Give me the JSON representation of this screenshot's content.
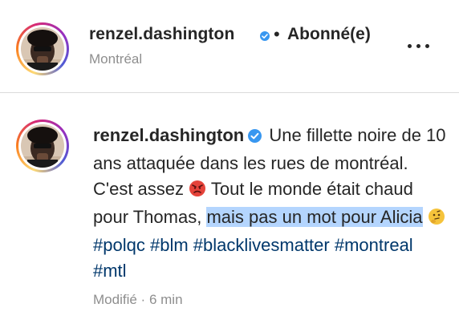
{
  "header": {
    "username": "renzel.dashington",
    "separator": "•",
    "follow_status": "Abonné(e)",
    "location": "Montréal"
  },
  "post": {
    "username": "renzel.dashington",
    "caption_part1": "Une fillette noire de 10 ans attaquée dans les rues de montréal. C'est assez",
    "caption_part2": "Tout le monde était chaud pour Thomas,",
    "caption_highlight": "mais pas un mot pour Alicia",
    "hashtags": [
      "#polqc",
      "#blm",
      "#blacklivesmatter",
      "#montreal",
      "#mtl"
    ],
    "emoji_1": "angry-face-emoji",
    "emoji_2": "thinking-face-emoji",
    "edited_label": "Modifié",
    "time_separator": "·",
    "time_ago": "6 min"
  },
  "colors": {
    "text": "#262626",
    "secondary": "#8e8e8e",
    "hashtag": "#00376b",
    "verified": "#3897f0",
    "highlight": "#b4d5fe"
  }
}
